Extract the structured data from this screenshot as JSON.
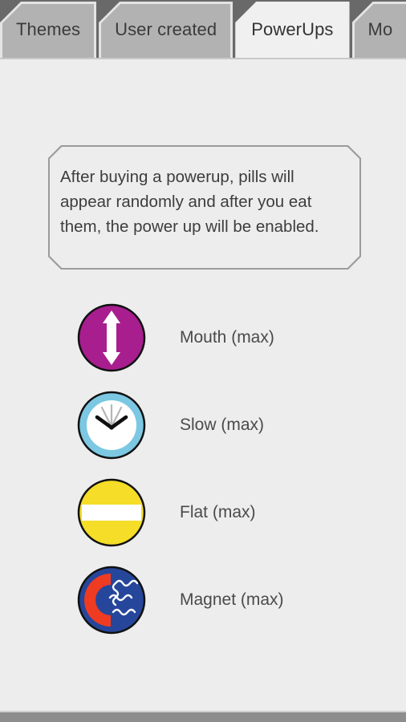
{
  "window": {
    "title": "PowerUps",
    "background_color": "#ededed",
    "tabbar_background": "#696969",
    "bottom_bar_color": "#8d8d8d"
  },
  "tabs": [
    {
      "label": "Themes",
      "active": false
    },
    {
      "label": "User created",
      "active": false
    },
    {
      "label": "PowerUps",
      "active": true
    },
    {
      "label": "Mo",
      "active": false
    }
  ],
  "info": {
    "text": "After buying a powerup, pills will appear randomly and after you eat them, the power up will be enabled."
  },
  "powerups": [
    {
      "label": "Mouth (max)",
      "icon": "mouth-arrow-icon",
      "circle_color": "#A81E8F",
      "accent_color": "#ffffff"
    },
    {
      "label": "Slow (max)",
      "icon": "clock-icon",
      "circle_color": "#7CC8E2",
      "accent_color": "#ffffff"
    },
    {
      "label": "Flat (max)",
      "icon": "flat-bar-icon",
      "circle_color": "#F5DD28",
      "accent_color": "#ffffff"
    },
    {
      "label": "Magnet (max)",
      "icon": "magnet-icon",
      "circle_color": "#26469B",
      "accent_color": "#EE3B22"
    }
  ]
}
